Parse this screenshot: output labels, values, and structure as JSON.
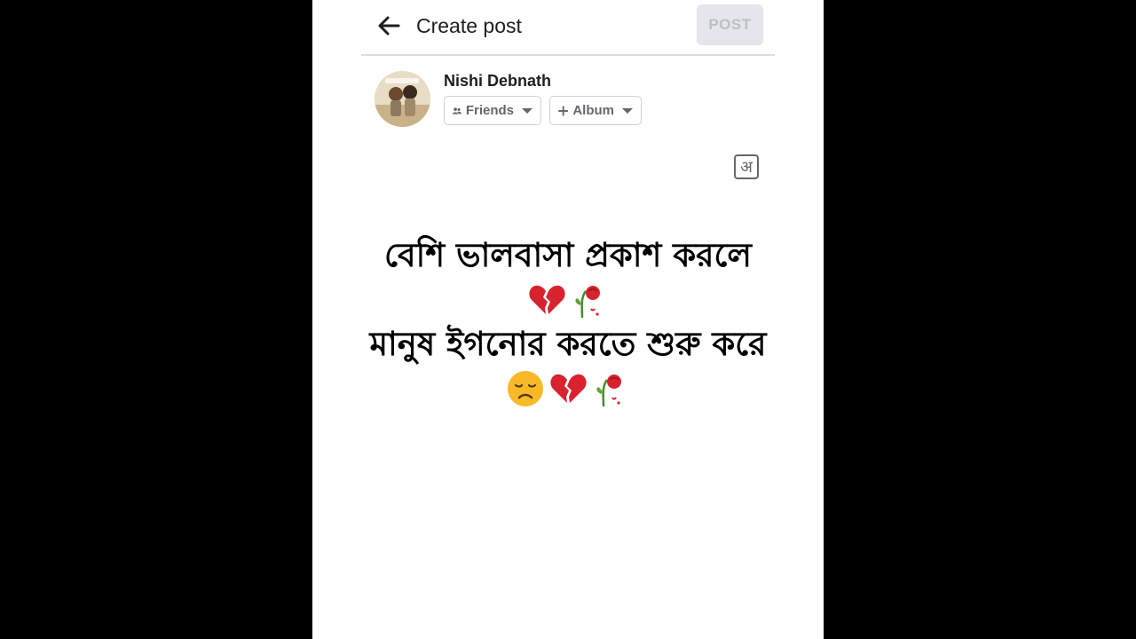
{
  "header": {
    "title": "Create post",
    "post_label": "POST"
  },
  "author": {
    "name": "Nishi Debnath",
    "audience_label": "Friends",
    "album_label": "Album"
  },
  "toolbar": {
    "language_glyph": "अ"
  },
  "post": {
    "line1": "বেশি ভালবাসা প্রকাশ করলে",
    "line1_emojis": [
      "broken-heart-icon",
      "wilted-rose-icon"
    ],
    "line2": "মানুষ ইগনোর করতে শুরু করে",
    "line2_emojis": [
      "disappointed-face-icon",
      "broken-heart-icon",
      "wilted-rose-icon"
    ]
  },
  "colors": {
    "post_button_bg": "#e4e6eb",
    "post_button_text": "#bcc0c4",
    "heart": "#d8232f",
    "face": "#f7b928"
  }
}
